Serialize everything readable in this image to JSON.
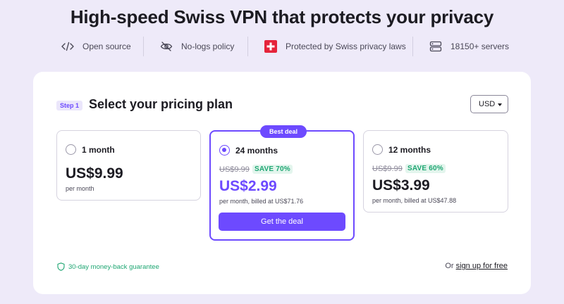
{
  "headline": "High-speed Swiss VPN that protects your privacy",
  "features": [
    {
      "icon": "code-icon",
      "label": "Open source"
    },
    {
      "icon": "eye-off-icon",
      "label": "No-logs policy"
    },
    {
      "icon": "swiss-flag-icon",
      "label": "Protected by Swiss privacy laws"
    },
    {
      "icon": "servers-icon",
      "label": "18150+ servers"
    }
  ],
  "pricing": {
    "step_label": "Step 1",
    "title": "Select your pricing plan",
    "currency": "USD",
    "plans": [
      {
        "name": "1 month",
        "price": "US$9.99",
        "note": "per month",
        "selected": false
      },
      {
        "name": "24 months",
        "badge": "Best deal",
        "old_price": "US$9.99",
        "save": "SAVE 70%",
        "price": "US$2.99",
        "note": "per month, billed at US$71.76",
        "cta": "Get the deal",
        "selected": true
      },
      {
        "name": "12 months",
        "old_price": "US$9.99",
        "save": "SAVE 60%",
        "price": "US$3.99",
        "note": "per month, billed at US$47.88",
        "selected": false
      }
    ],
    "guarantee": "30-day money-back guarantee",
    "signup_prefix": "Or",
    "signup_link": "sign up for free"
  },
  "colors": {
    "accent": "#6d4aff",
    "save_green": "#1ea672",
    "background": "#eeeaf9",
    "swiss_red": "#e5243b"
  }
}
